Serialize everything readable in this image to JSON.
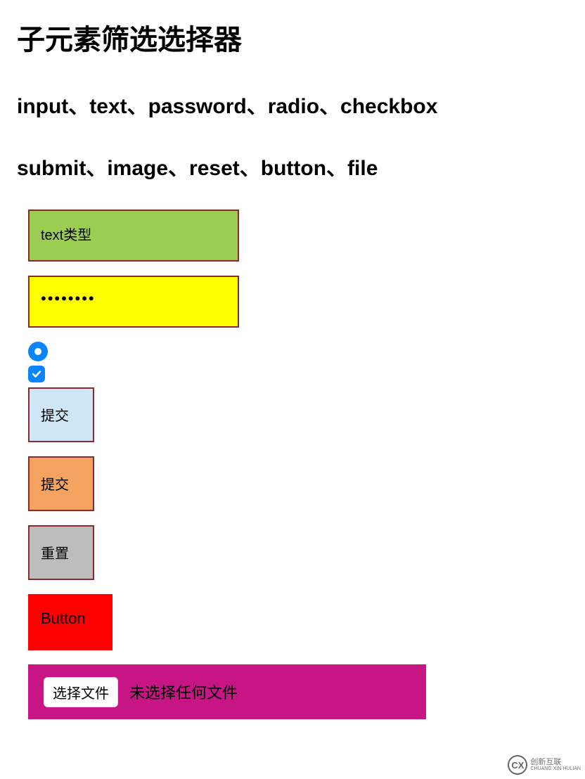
{
  "title": "子元素筛选选择器",
  "subtitle1": "input、text、password、radio、checkbox",
  "subtitle2": "submit、image、reset、button、file",
  "fields": {
    "text_value": "text类型",
    "password_value": "••••••••",
    "submit_label": "提交",
    "image_label": "提交",
    "reset_label": "重置",
    "button_label": "Button",
    "file_button": "选择文件",
    "file_status": "未选择任何文件"
  },
  "watermark": {
    "logo": "CX",
    "line1": "创新互联",
    "line2": "CHUANG XIN HULIAN"
  }
}
